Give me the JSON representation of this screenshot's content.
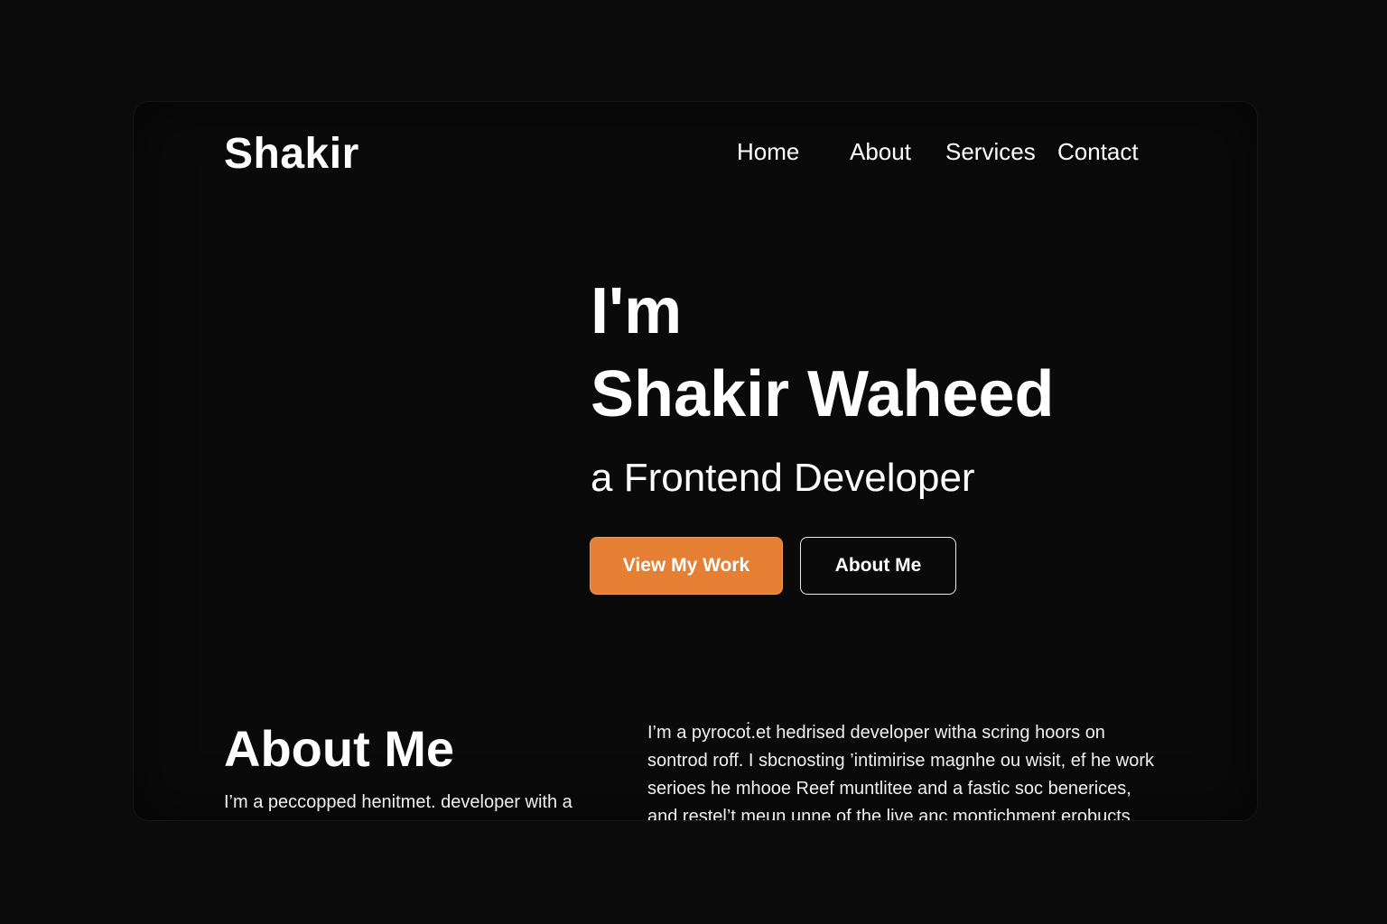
{
  "site": {
    "logo": "Shakir"
  },
  "nav": {
    "items": [
      {
        "label": "Home"
      },
      {
        "label": "About"
      },
      {
        "label": "Services"
      },
      {
        "label": "Contact"
      }
    ]
  },
  "hero": {
    "intro": "I'm",
    "name": "Shakir Waheed",
    "role": "a Frontend Developer",
    "primary_button": "View My Work",
    "secondary_button": "About Me"
  },
  "about": {
    "heading": "About Me",
    "lead": "I’m a peccopped henitmet. developer  with a",
    "body_lines": [
      "I’m a pyrocoṫ.et hedrised developer witha scring hoors on",
      "sontrod roff. I sbcnosting ’intimirise magnhe ou wisit, ef he work",
      "serioes he mhooe Reef muntlitee and a fastic soc benerices,",
      "and restel’t meun unne of the live anc montichment.erobucts"
    ]
  },
  "colors": {
    "background": "#0b0b0b",
    "accent": "#e57f33",
    "text": "#ffffff"
  }
}
